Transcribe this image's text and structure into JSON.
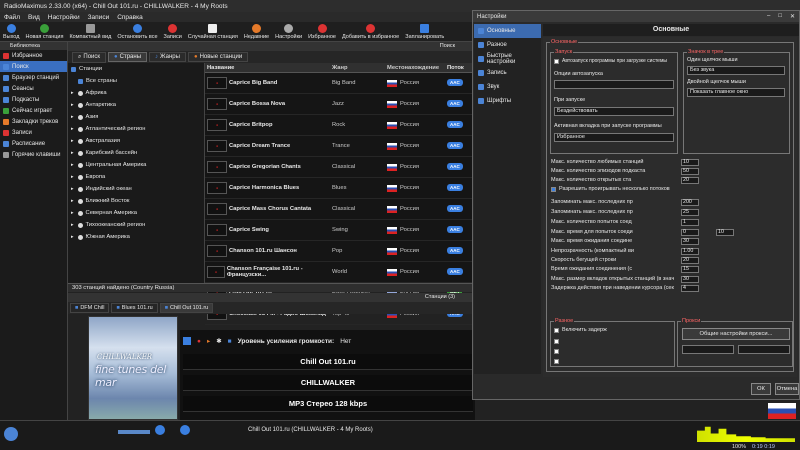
{
  "window": {
    "title": "RadioMaximus 2.33.00 (x64) - Chill Out 101.ru - CHILLWALKER - 4 My Roots"
  },
  "menu": [
    "Файл",
    "Вид",
    "Настройки",
    "Записи",
    "Справка"
  ],
  "toolbar": [
    "Выход",
    "Новая станция",
    "Компактный вид",
    "Остановить все",
    "Записи",
    "Случайная станция",
    "Недавние",
    "Настройки",
    "Избранное",
    "Добавить в избранное",
    "Запланировать"
  ],
  "sidebar": {
    "header": "Библиотека",
    "items": [
      "Избранное",
      "Поиск",
      "Браузер станций",
      "Сеансы",
      "Подкасты",
      "Сейчас играет",
      "Закладки треков",
      "Записи",
      "Расписание",
      "Горячие клавиши"
    ]
  },
  "search_header": "Поиск",
  "tabs": [
    "Поиск",
    "Страны",
    "Жанры",
    "Новые станции"
  ],
  "tree": [
    "Станции",
    "Все страны",
    "Африка",
    "Антарктика",
    "Азия",
    "Атлантический регион",
    "Австралазия",
    "Карибский бассейн",
    "Центральная Америка",
    "Европа",
    "Индийский океан",
    "Ближний Восток",
    "Северная Америка",
    "Тихоокеанский регион",
    "Южная Америка"
  ],
  "table": {
    "headers": [
      "Название",
      "Жанр",
      "Местонахождение",
      "Поток"
    ],
    "rows": [
      {
        "name": "Caprice Big Band",
        "genre": "Big Band",
        "loc": "Россия",
        "fmt": "AAC"
      },
      {
        "name": "Caprice Bossa Nova",
        "genre": "Jazz",
        "loc": "Россия",
        "fmt": "AAC"
      },
      {
        "name": "Caprice Britpop",
        "genre": "Rock",
        "loc": "Россия",
        "fmt": "AAC"
      },
      {
        "name": "Caprice Dream Trance",
        "genre": "Trance",
        "loc": "Россия",
        "fmt": "AAC"
      },
      {
        "name": "Caprice Gregorian Chants",
        "genre": "Classical",
        "loc": "Россия",
        "fmt": "AAC"
      },
      {
        "name": "Caprice Harmonica Blues",
        "genre": "Blues",
        "loc": "Россия",
        "fmt": "AAC"
      },
      {
        "name": "Caprice Mass Chorus Cantata",
        "genre": "Classical",
        "loc": "Россия",
        "fmt": "AAC"
      },
      {
        "name": "Caprice Swing",
        "genre": "Swing",
        "loc": "Россия",
        "fmt": "AAC"
      },
      {
        "name": "Chanson 101.ru Шансон",
        "genre": "Pop",
        "loc": "Россия",
        "fmt": "AAC"
      },
      {
        "name": "Chanson Française 101.ru - Французски...",
        "genre": "World",
        "loc": "Россия",
        "fmt": "AAC"
      },
      {
        "name": "Chill Out 101.ru",
        "genre": "Easy Listening",
        "loc": "Россия",
        "fmt": "MP3"
      },
      {
        "name": "Chocolate 98 FM - Радио Шоколад",
        "genre": "Top 40",
        "loc": "Россия",
        "fmt": "AAC"
      }
    ]
  },
  "found_count": "303 станций найдено (Country Russia)",
  "stations_header": "Станции (3)",
  "player_tabs": [
    "DFM Chill",
    "Blues 101.ru",
    "Chill Out 101.ru"
  ],
  "cover": {
    "line1": "CHILLWALKER",
    "line2": "fine tunes del mar"
  },
  "volume_label": "Уровень усиления громкости:",
  "volume_value": "Нет",
  "now_station": "Chill Out 101.ru",
  "now_artist": "CHILLWALKER",
  "now_stream": "MP3 Стерео 128 kbps",
  "status_track": "Chill Out 101.ru (CHILLWALKER - 4 My Roots)",
  "status_percent": "100%",
  "status_time": "0:19  0:19",
  "dialog": {
    "title": "Настройки",
    "header": "Основные",
    "nav": [
      "Основные",
      "Разное",
      "Быстрые настройки",
      "Запись",
      "Звук",
      "Шрифты"
    ],
    "grp_basic": "Основные",
    "grp_launch": "Запуск",
    "autorun": "Автозапуск программы при загрузке системы",
    "autorun_opts": "Опции автозапуска",
    "on_start": "При запуске",
    "on_start_value": "Бездействовать",
    "active_tab": "Активная вкладка при запуске программы",
    "active_tab_value": "Избранное",
    "grp_tray": "Значок в трее",
    "single_click": "Один щелчок мыши",
    "single_click_value": "Без звука",
    "double_click": "Двойной щелчок мыши",
    "double_click_value": "Показать главное окно",
    "settings": [
      {
        "label": "Макс. количество любимых станций",
        "value": "10"
      },
      {
        "label": "Макс. количество эпизодов подкаста",
        "value": "50"
      },
      {
        "label": "Макс. количество открытых ста",
        "value": "20"
      },
      {
        "label": "Запоминать макс. последних пр",
        "value": "200"
      },
      {
        "label": "Запоминать макс. последних пр",
        "value": "25"
      },
      {
        "label": "Макс. количество попыток соед",
        "value": "1"
      },
      {
        "label": "Макс. время для попыток соеди",
        "value": "0"
      },
      {
        "label": "Макс. время ожидания соедине",
        "value": "30"
      },
      {
        "label": "Непрозрачность (компактный ви",
        "value": "1.00"
      },
      {
        "label": "Скорость бегущей строки",
        "value": "20"
      },
      {
        "label": "Время ожидания соединения (с",
        "value": "15"
      },
      {
        "label": "Макс. размер вкладок открытых станций (в знач",
        "value": "30"
      },
      {
        "label": "Задержка действия при наведении курсора (сек",
        "value": "4"
      }
    ],
    "extra_value": "10",
    "multi_stream": "Разрешить проигрывать несколько потоков",
    "grp_misc": "Разное",
    "delay": "Включить задерж",
    "grp_proxy": "Прокси",
    "proxy_btn": "Общие настройки прокси...",
    "ok": "ОК",
    "cancel": "Отмена"
  }
}
